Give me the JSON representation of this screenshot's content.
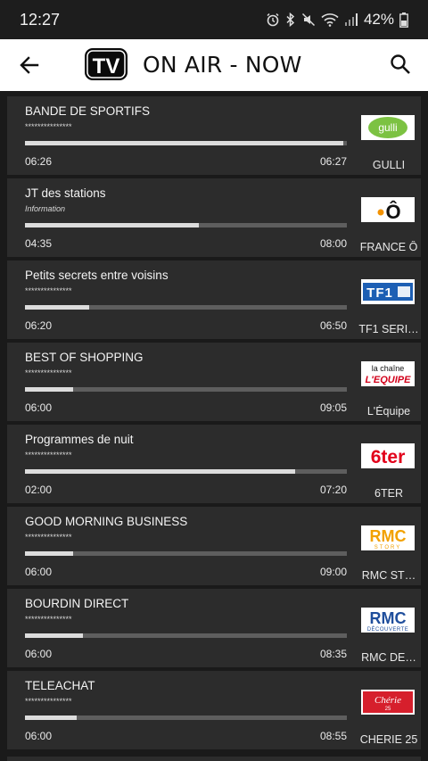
{
  "status": {
    "time": "12:27",
    "battery": "42%"
  },
  "appbar": {
    "title": "ON AIR - NOW",
    "logo_text": "TV"
  },
  "programs": [
    {
      "title": "BANDE DE SPORTIFS",
      "subtitle": "***************",
      "start": "06:26",
      "end": "06:27",
      "progress": 0.99,
      "channel": "GULLI",
      "logo": "gulli-logo",
      "logo_text": "gulli"
    },
    {
      "title": "JT des stations",
      "subtitle": "Information",
      "start": "04:35",
      "end": "08:00",
      "progress": 0.54,
      "channel": "FRANCE Ô",
      "logo": "france-o-logo",
      "logo_text": "Ô"
    },
    {
      "title": "Petits secrets entre voisins",
      "subtitle": "***************",
      "start": "06:20",
      "end": "06:50",
      "progress": 0.2,
      "channel": "TF1 SERI…",
      "logo": "tf1-series-logo",
      "logo_text": "TF1"
    },
    {
      "title": "BEST OF SHOPPING",
      "subtitle": "***************",
      "start": "06:00",
      "end": "09:05",
      "progress": 0.15,
      "channel": "L'Équipe",
      "logo": "lequipe-logo",
      "logo_text_1": "la chaîne",
      "logo_text_2": "L'EQUIPE"
    },
    {
      "title": "Programmes de nuit",
      "subtitle": "***************",
      "start": "02:00",
      "end": "07:20",
      "progress": 0.84,
      "channel": "6TER",
      "logo": "6ter-logo",
      "logo_text": "6ter"
    },
    {
      "title": "GOOD MORNING BUSINESS",
      "subtitle": "***************",
      "start": "06:00",
      "end": "09:00",
      "progress": 0.15,
      "channel": "RMC ST…",
      "logo": "rmc-story-logo",
      "logo_text": "RMC",
      "logo_sub": "STORY"
    },
    {
      "title": "BOURDIN DIRECT",
      "subtitle": "***************",
      "start": "06:00",
      "end": "08:35",
      "progress": 0.18,
      "channel": "RMC DE…",
      "logo": "rmc-decouverte-logo",
      "logo_text": "RMC",
      "logo_sub": "DÉCOUVERTE"
    },
    {
      "title": "TELEACHAT",
      "subtitle": "***************",
      "start": "06:00",
      "end": "08:55",
      "progress": 0.16,
      "channel": "CHERIE 25",
      "logo": "cherie25-logo",
      "logo_text": "Chérie",
      "logo_sub": "25"
    }
  ]
}
